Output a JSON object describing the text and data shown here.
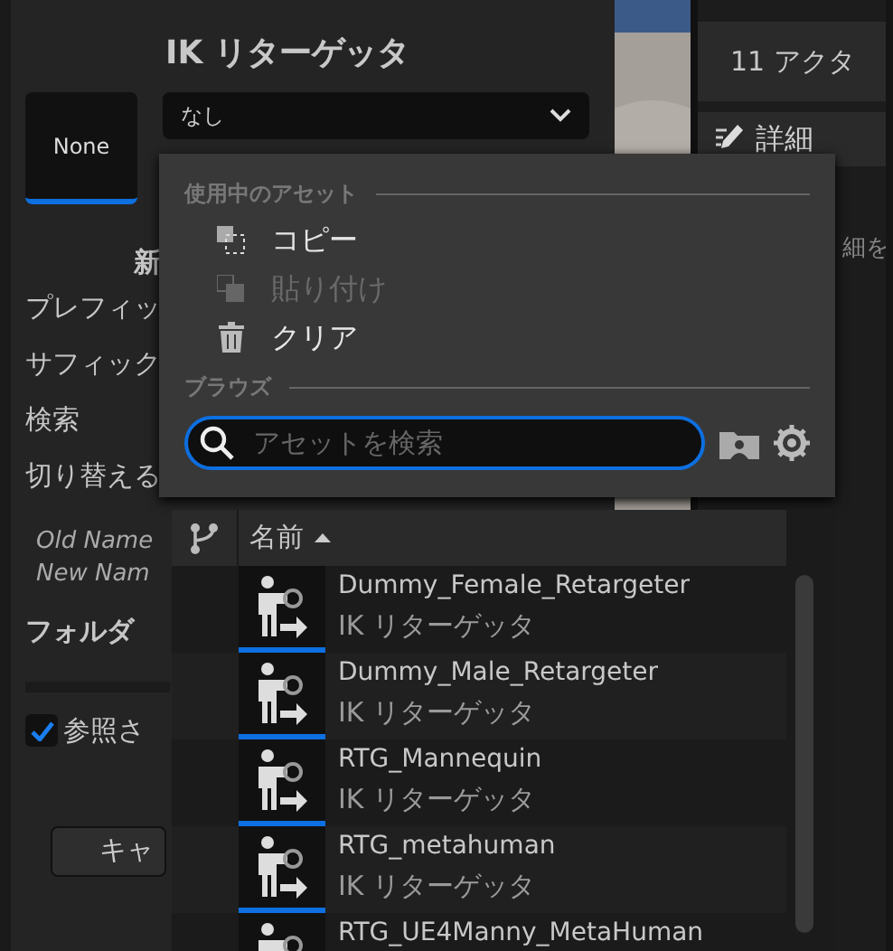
{
  "dialog": {
    "title": "IK リターゲッタ",
    "thumbnail": "None",
    "combo": {
      "value": "なし"
    },
    "fields": [
      {
        "kind": "section",
        "text": "新"
      },
      {
        "kind": "label",
        "text": "プレフィッ"
      },
      {
        "kind": "label",
        "text": "サフィック"
      },
      {
        "kind": "label",
        "text": "検索"
      },
      {
        "kind": "label",
        "text": "切り替える"
      },
      {
        "kind": "note",
        "text": "Old Name"
      },
      {
        "kind": "note",
        "text": "New Nam"
      },
      {
        "kind": "heading",
        "text": "フォルダ"
      },
      {
        "kind": "checkbox",
        "text": "参照さ",
        "checked": true
      },
      {
        "kind": "button",
        "text": "キャ"
      }
    ]
  },
  "right_panel": {
    "actors": "11 アクタ",
    "tab": "詳細",
    "hint": "細を"
  },
  "picker": {
    "sections": [
      {
        "heading": "使用中のアセット",
        "items": [
          {
            "kind": "copy",
            "label": "コピー",
            "disabled": false
          },
          {
            "kind": "paste",
            "label": "貼り付け",
            "disabled": true
          },
          {
            "kind": "clear",
            "label": "クリア",
            "disabled": false
          }
        ]
      },
      {
        "heading": "ブラウズ"
      }
    ],
    "search": {
      "placeholder": "アセットを検索"
    },
    "column": "名前",
    "rows": [
      {
        "name": "Dummy_Female_Retargeter",
        "type": "IK リターゲッタ"
      },
      {
        "name": "Dummy_Male_Retargeter",
        "type": "IK リターゲッタ"
      },
      {
        "name": "RTG_Mannequin",
        "type": "IK リターゲッタ"
      },
      {
        "name": "RTG_metahuman",
        "type": "IK リターゲッタ"
      },
      {
        "name": "RTG_UE4Manny_MetaHuman"
      }
    ]
  }
}
